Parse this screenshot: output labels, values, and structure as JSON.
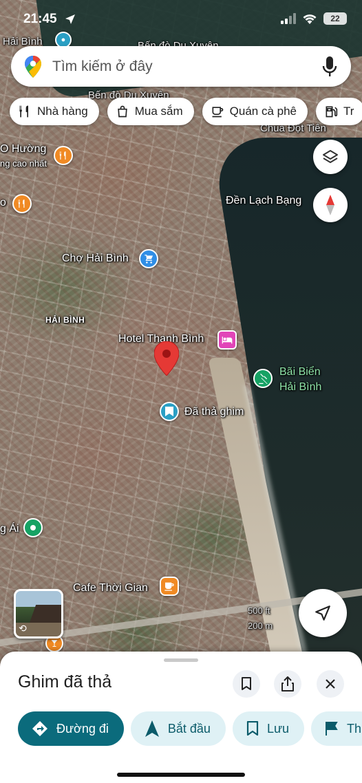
{
  "status_bar": {
    "time": "21:45",
    "battery": "22"
  },
  "search": {
    "placeholder": "Tìm kiếm ở đây"
  },
  "chips": [
    {
      "icon": "fork-knife-icon",
      "label": "Nhà hàng"
    },
    {
      "icon": "shopping-bag-icon",
      "label": "Mua sắm"
    },
    {
      "icon": "coffee-cup-icon",
      "label": "Quán cà phê"
    },
    {
      "icon": "gas-pump-icon",
      "label": "Tr"
    }
  ],
  "map": {
    "labels": {
      "hai_binh_top": "Hải Bình",
      "ben_do_top": "Bến đò Du Xuyên",
      "ben_do": "Bến đò Du Xuyên",
      "chua": "Chùa Đột Tiên",
      "o_huong": "O Hường",
      "ng_cao_nhat": "ng cao nhất",
      "o_left": "o",
      "den_lach_bang": "Đền Lạch Bạng",
      "cho_hai_binh": "Chợ Hải Bình",
      "hai_binh_area": "HẢI BÌNH",
      "hotel": "Hotel Thanh Bình",
      "beach_line1": "Bãi Biển",
      "beach_line2": "Hải Bình",
      "dropped_pin": "Đã thả ghim",
      "g_ai": "g Ái",
      "cafe": "Cafe Thời Gian",
      "scale_ft": "500 ft",
      "scale_m": "200 m"
    }
  },
  "sheet": {
    "title": "Ghim đã thả",
    "actions": [
      {
        "icon": "directions-icon",
        "label": "Đường đi",
        "primary": true
      },
      {
        "icon": "navigation-arrow-icon",
        "label": "Bắt đầu",
        "primary": false
      },
      {
        "icon": "bookmark-icon",
        "label": "Lưu",
        "primary": false
      },
      {
        "icon": "flag-icon",
        "label": "Th",
        "primary": false
      }
    ]
  },
  "colors": {
    "primary_action": "#0b6b7c",
    "pin_red": "#e53935",
    "poi_orange": "#f08a24",
    "poi_blue": "#2f8ee6",
    "poi_pink": "#e145b8",
    "poi_green": "#16a264"
  }
}
